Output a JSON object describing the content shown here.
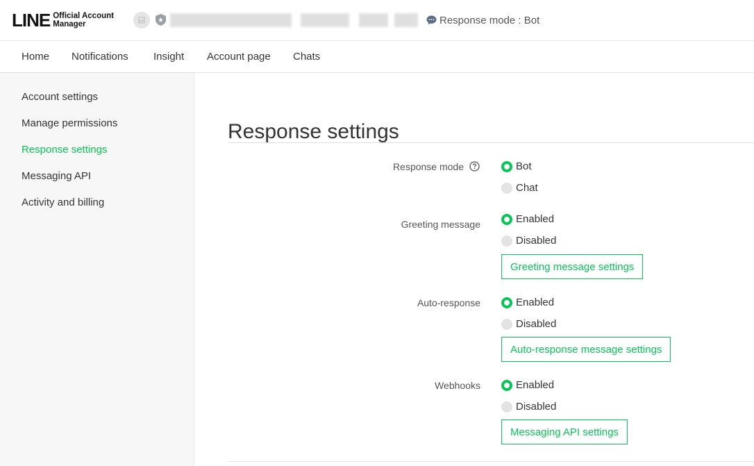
{
  "header": {
    "logo_main": "LINE",
    "logo_sub_line1": "Official Account",
    "logo_sub_line2": "Manager",
    "response_mode_indicator": "Response mode : Bot"
  },
  "nav": {
    "tabs": [
      "Home",
      "Notifications",
      "Insight",
      "Account page",
      "Chats"
    ]
  },
  "sidebar": {
    "items": [
      {
        "label": "Account settings"
      },
      {
        "label": "Manage permissions"
      },
      {
        "label": "Response settings",
        "active": true
      },
      {
        "label": "Messaging API"
      },
      {
        "label": "Activity and billing"
      }
    ]
  },
  "main": {
    "title": "Response settings",
    "sections": [
      {
        "label": "Response mode",
        "options": [
          {
            "label": "Bot",
            "selected": true
          },
          {
            "label": "Chat",
            "selected": false
          }
        ]
      },
      {
        "label": "Greeting message",
        "options": [
          {
            "label": "Enabled",
            "selected": true
          },
          {
            "label": "Disabled",
            "selected": false
          }
        ],
        "button": "Greeting message settings"
      },
      {
        "label": "Auto-response",
        "options": [
          {
            "label": "Enabled",
            "selected": true
          },
          {
            "label": "Disabled",
            "selected": false
          }
        ],
        "button": "Auto-response message settings"
      },
      {
        "label": "Webhooks",
        "options": [
          {
            "label": "Enabled",
            "selected": true
          },
          {
            "label": "Disabled",
            "selected": false
          }
        ],
        "button": "Messaging API settings"
      }
    ]
  },
  "colors": {
    "accent": "#06c755",
    "sidebar_bg": "#f7f7f7"
  }
}
